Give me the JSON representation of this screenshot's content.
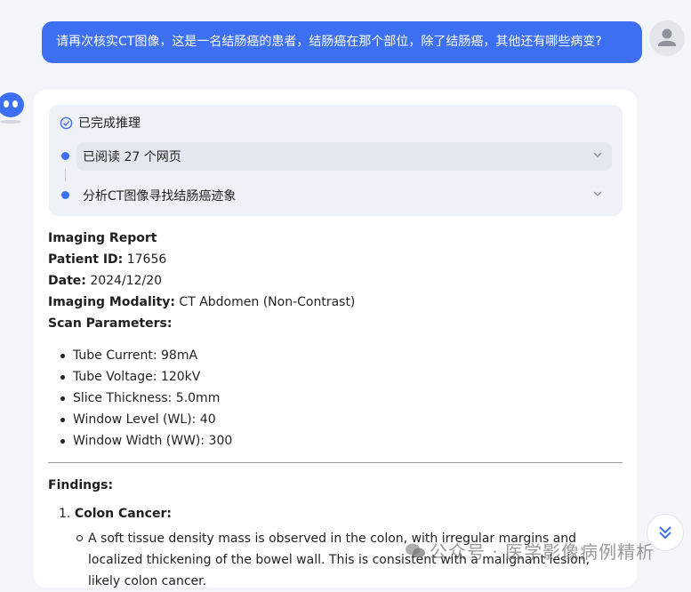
{
  "user_message": {
    "text": "请再次核实CT图像，这是一名结肠癌的患者，结肠癌在那个部位，除了结肠癌，其他还有哪些病变?"
  },
  "reasoning": {
    "status": "已完成推理",
    "steps": [
      {
        "label": "已阅读 27 个网页"
      },
      {
        "label": "分析CT图像寻找结肠癌迹象"
      }
    ]
  },
  "report": {
    "title": "Imaging Report",
    "patient_id_label": "Patient ID:",
    "patient_id": "17656",
    "date_label": "Date:",
    "date": "2024/12/20",
    "modality_label": "Imaging Modality:",
    "modality": "CT Abdomen (Non-Contrast)",
    "scan_params_label": "Scan Parameters:",
    "scan_params": [
      "Tube Current: 98mA",
      "Tube Voltage: 120kV",
      "Slice Thickness: 5.0mm",
      "Window Level (WL): 40",
      "Window Width (WW): 300"
    ],
    "findings_label": "Findings:",
    "finding_number": "1.",
    "finding_title": "Colon Cancer:",
    "finding_text": "A soft tissue density mass is observed in the colon, with irregular margins and localized thickening of the bowel wall. This is consistent with a malignant lesion, likely colon cancer."
  },
  "watermark": {
    "text": "公众号 · 医学影像病例精析"
  },
  "colors": {
    "accent": "#3d6ff2",
    "card": "#ffffff",
    "panel": "#eef1f7"
  }
}
